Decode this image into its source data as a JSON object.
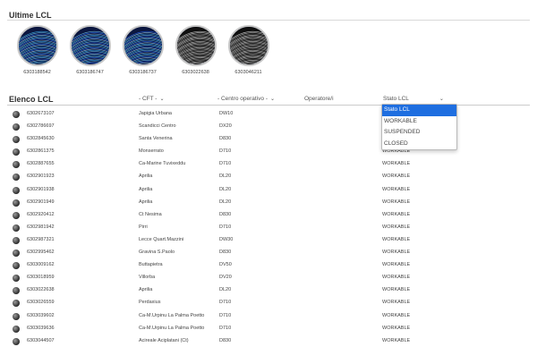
{
  "recent": {
    "title": "Ultime LCL",
    "items": [
      {
        "label": "6303188542",
        "style": "blue"
      },
      {
        "label": "6303186747",
        "style": "blue"
      },
      {
        "label": "6303186737",
        "style": "blue"
      },
      {
        "label": "6303022638",
        "style": "grey"
      },
      {
        "label": "6303046211",
        "style": "grey"
      }
    ]
  },
  "list": {
    "title": "Elenco LCL",
    "filters": {
      "cft": "- CFT -",
      "centro": "- Centro operativo -",
      "operatore": "Operatore/i",
      "stato": "Stato LCL"
    },
    "rows": [
      {
        "id": "6302673107",
        "name": "Japigia Urbana",
        "co": "DW10",
        "status": ""
      },
      {
        "id": "6302786697",
        "name": "Scandicci Centro",
        "co": "DX20",
        "status": ""
      },
      {
        "id": "6302845630",
        "name": "Santa Venerina",
        "co": "D830",
        "status": ""
      },
      {
        "id": "6302861375",
        "name": "Monserrato",
        "co": "D710",
        "status": "WORKABLE"
      },
      {
        "id": "6302887655",
        "name": "Ca-Marine Tuvixeddu",
        "co": "D710",
        "status": "WORKABLE"
      },
      {
        "id": "6302901923",
        "name": "Aprilia",
        "co": "DL20",
        "status": "WORKABLE"
      },
      {
        "id": "6302901938",
        "name": "Aprilia",
        "co": "DL20",
        "status": "WORKABLE"
      },
      {
        "id": "6302901949",
        "name": "Aprilia",
        "co": "DL20",
        "status": "WORKABLE"
      },
      {
        "id": "6302920412",
        "name": "Ct Nesima",
        "co": "D830",
        "status": "WORKABLE"
      },
      {
        "id": "6302981942",
        "name": "Pirri",
        "co": "D710",
        "status": "WORKABLE"
      },
      {
        "id": "6302987321",
        "name": "Lecce Quart.Mazzini",
        "co": "DW30",
        "status": "WORKABLE"
      },
      {
        "id": "6302995462",
        "name": "Gravina S.Paolo",
        "co": "D830",
        "status": "WORKABLE"
      },
      {
        "id": "6303009162",
        "name": "Buttapietra",
        "co": "DV50",
        "status": "WORKABLE"
      },
      {
        "id": "6303018959",
        "name": "Villorba",
        "co": "DV20",
        "status": "WORKABLE"
      },
      {
        "id": "6303022638",
        "name": "Aprilia",
        "co": "DL20",
        "status": "WORKABLE"
      },
      {
        "id": "6303026559",
        "name": "Perdaxius",
        "co": "D710",
        "status": "WORKABLE"
      },
      {
        "id": "6303039602",
        "name": "Ca-M.Urpinu La Palma Poetto",
        "co": "D710",
        "status": "WORKABLE"
      },
      {
        "id": "6303039636",
        "name": "Ca-M.Urpinu La Palma Poetto",
        "co": "D710",
        "status": "WORKABLE"
      },
      {
        "id": "6303044507",
        "name": "Acireale Aciplatani (Ct)",
        "co": "D830",
        "status": "WORKABLE"
      }
    ]
  },
  "status_dropdown": {
    "options": [
      {
        "label": "Stato LCL",
        "selected": true
      },
      {
        "label": "WORKABLE",
        "selected": false
      },
      {
        "label": "SUSPENDED",
        "selected": false
      },
      {
        "label": "CLOSED",
        "selected": false
      }
    ]
  }
}
